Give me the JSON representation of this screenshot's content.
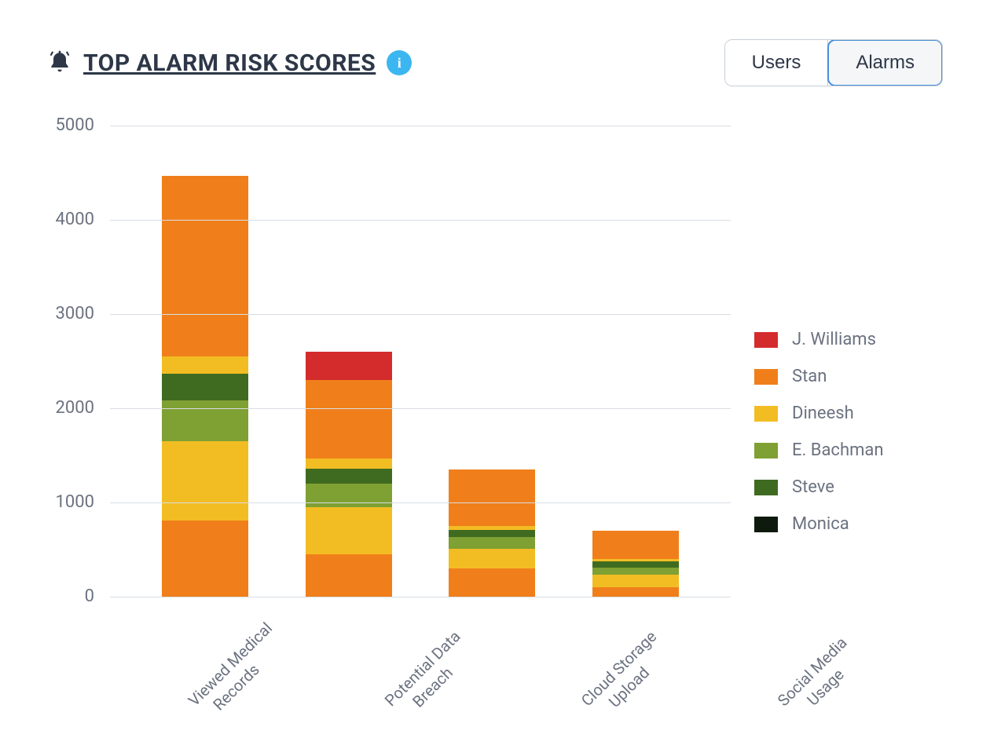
{
  "header": {
    "title": "TOP ALARM RISK SCORES",
    "info_symbol": "i"
  },
  "toggle": {
    "users": "Users",
    "alarms": "Alarms",
    "active": "alarms"
  },
  "chart_data": {
    "type": "bar",
    "stacked": true,
    "ylim": [
      0,
      5000
    ],
    "yticks": [
      5000,
      4000,
      3000,
      2000,
      1000,
      0
    ],
    "categories": [
      "Viewed Medical Records",
      "Potential Data Breach",
      "Cloud Storage Upload",
      "Social Media Usage"
    ],
    "series": [
      {
        "name": "J. Williams",
        "color": "#d42c2c",
        "values": [
          0,
          300,
          0,
          0
        ]
      },
      {
        "name": "Stan",
        "color": "#f07f1b",
        "values": [
          1920,
          830,
          600,
          300
        ]
      },
      {
        "name": "Dineesh",
        "color": "#f2bd23",
        "values": [
          1020,
          610,
          250,
          160
        ]
      },
      {
        "name": "E. Bachman",
        "color": "#7fa033",
        "values": [
          440,
          250,
          130,
          80
        ]
      },
      {
        "name": "Steve",
        "color": "#3f6b20",
        "values": [
          280,
          160,
          70,
          60
        ]
      },
      {
        "name": "Monica",
        "color": "#0e1a0d",
        "values": [
          0,
          0,
          0,
          0
        ]
      },
      {
        "name": "_bottom",
        "color": "#f07f1b",
        "values": [
          610,
          350,
          200,
          50
        ],
        "hidden_in_legend": true
      },
      {
        "name": "_thin",
        "color": "#f07f1b",
        "values": [
          200,
          100,
          100,
          50
        ],
        "hidden_in_legend": true
      }
    ],
    "legend_order": [
      "J. Williams",
      "Stan",
      "Dineesh",
      "E. Bachman",
      "Steve",
      "Monica"
    ],
    "stack_order_bottom_to_top": [
      "_bottom",
      "_thin",
      "Dineesh",
      "E. Bachman",
      "Steve",
      "Dineesh2",
      "Stan",
      "J. Williams"
    ]
  }
}
